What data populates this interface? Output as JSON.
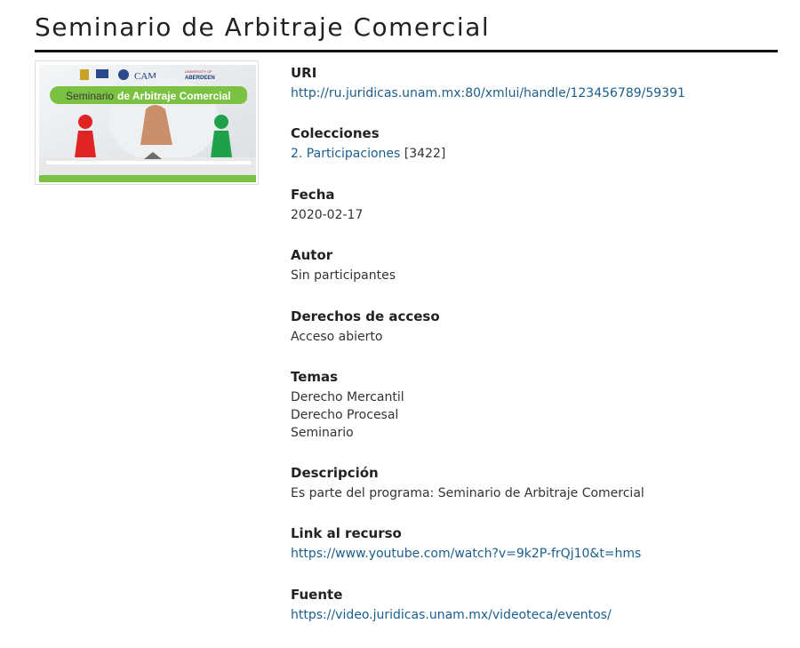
{
  "page": {
    "title": "Seminario de Arbitraje Comercial"
  },
  "thumbnail": {
    "banner_text_a": "Seminario",
    "banner_text_b": "de Arbitraje Comercial",
    "logo_cam": "CAM",
    "logo_univ_small": "UNIVERSITY OF",
    "logo_univ": "ABERDEEN"
  },
  "fields": {
    "uri": {
      "label": "URI",
      "value": "http://ru.juridicas.unam.mx:80/xmlui/handle/123456789/59391"
    },
    "colecciones": {
      "label": "Colecciones",
      "link": "2. Participaciones",
      "count": "[3422]"
    },
    "fecha": {
      "label": "Fecha",
      "value": "2020-02-17"
    },
    "autor": {
      "label": "Autor",
      "value": "Sin participantes"
    },
    "derechos": {
      "label": "Derechos de acceso",
      "value": "Acceso abierto"
    },
    "temas": {
      "label": "Temas",
      "values": [
        "Derecho Mercantil",
        "Derecho Procesal",
        "Seminario"
      ]
    },
    "descripcion": {
      "label": "Descripción",
      "value": "Es parte del programa: Seminario de Arbitraje Comercial"
    },
    "link_recurso": {
      "label": "Link al recurso",
      "value": "https://www.youtube.com/watch?v=9k2P-frQj10&t=hms"
    },
    "fuente": {
      "label": "Fuente",
      "value": "https://video.juridicas.unam.mx/videoteca/eventos/"
    }
  },
  "colors": {
    "link": "#1a5e8e",
    "banner_green": "#7cc242",
    "accent_red": "#e02424",
    "accent_green": "#1fa04a"
  }
}
